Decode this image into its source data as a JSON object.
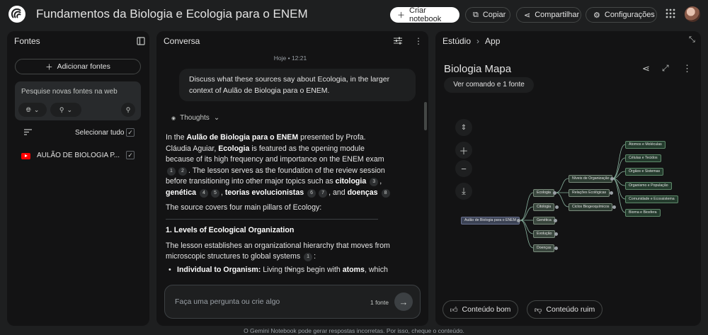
{
  "header": {
    "title": "Fundamentos da Biologia e Ecologia para o ENEM",
    "create_notebook": "Criar notebook",
    "copy": "Copiar",
    "share": "Compartilhar",
    "settings": "Configurações"
  },
  "sources": {
    "title": "Fontes",
    "add_sources": "Adicionar fontes",
    "web_search_placeholder": "Pesquise novas fontes na web",
    "select_all": "Selecionar tudo",
    "items": [
      {
        "label": "AULÃO DE BIOLOGIA P...",
        "checked": true
      }
    ]
  },
  "chat": {
    "title": "Conversa",
    "timestamp": "Hoje • 12:21",
    "user_message": "Discuss what these sources say about Ecologia, in the larger context of Aulão de Biologia para o ENEM.",
    "thoughts": "Thoughts",
    "answer": {
      "p1_a": "In the ",
      "p1_b": "Aulão de Biologia para o ENEM",
      "p1_c": " presented by Profa. Cláudia Aguiar, ",
      "p1_d": "Ecologia",
      "p1_e": " is featured as the opening module because of its high frequency and importance on the ENEM exam",
      "p1_f": ". The lesson serves as the foundation of the review session before transitioning into other major topics such as ",
      "p1_g": "citologia",
      "p1_h": "genética",
      "p1_i": "teorias evolucionistas",
      "p1_j": ", and ",
      "p1_k": "doenças",
      "p2": "The source covers four main pillars of Ecology:",
      "h3": "1. Levels of Ecological Organization",
      "p3": "The lesson establishes an organizational hierarchy that moves from microscopic structures to global systems",
      "li1_a": "Individual to Organism:",
      "li1_b": " Living things begin with ",
      "li1_c": "atoms",
      "li1_d": ", which"
    },
    "citations": [
      "1",
      "2",
      "3",
      "4",
      "5",
      "6",
      "7",
      "8",
      "1"
    ],
    "input_placeholder": "Faça uma pergunta ou crie algo",
    "source_count": "1 fonte"
  },
  "studio": {
    "breadcrumb_root": "Estúdio",
    "breadcrumb_leaf": "App",
    "map_title": "Biologia Mapa",
    "view_command": "Ver comando e 1 fonte",
    "good_content": "Conteúdo bom",
    "bad_content": "Conteúdo ruim",
    "mindmap": {
      "root": "Aulão de Biologia para o ENEM",
      "level1": [
        "Ecologia",
        "Citologia",
        "Genética",
        "Evolução",
        "Doenças"
      ],
      "level2": [
        "Níveis de Organização",
        "Relações Ecológicas",
        "Ciclos Biogeoquímicos"
      ],
      "level3": [
        "Átomos e Moléculas",
        "Células e Tecidos",
        "Órgãos e Sistemas",
        "Organismo e População",
        "Comunidade e Ecossistema",
        "Bioma e Biosfera"
      ]
    }
  },
  "footer": "O Gemini Notebook pode gerar respostas incorretas. Por isso, cheque o conteúdo.",
  "colors": {
    "background": "#1e1f20",
    "panel": "#131314",
    "accent": "#ffffff"
  }
}
